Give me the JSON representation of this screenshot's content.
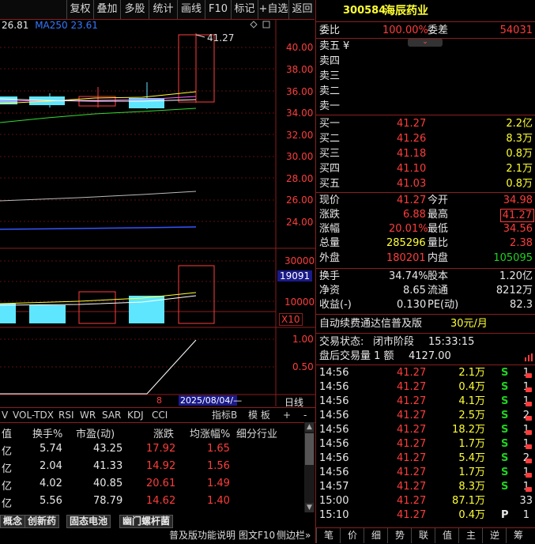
{
  "toolbar": {
    "items": [
      "复权",
      "叠加",
      "多股",
      "统计",
      "画线",
      "F10",
      "标记",
      "+自选",
      "返回"
    ]
  },
  "chart": {
    "ma_value": "26.81",
    "ma250_label": "MA250",
    "ma250_value": "23.61",
    "price_axis": [
      "40.00",
      "38.00",
      "36.00",
      "34.00",
      "32.00",
      "30.00",
      "28.00",
      "26.00",
      "24.00"
    ],
    "high_annotation": "41.27",
    "volume_axis": [
      "30000",
      "20000",
      "10000"
    ],
    "volume_current": "19091",
    "volume_unit": "X10",
    "indicator_axis": [
      "1.00",
      "0.50"
    ],
    "bottom_tick": "8",
    "date_label": "2025/08/04/—",
    "line_label": "日线"
  },
  "indicator_tabs": {
    "items": [
      "V",
      "VOL-TDX",
      "RSI",
      "WR",
      "SAR",
      "KDJ",
      "CCI"
    ],
    "right": [
      "指标B",
      "模 板",
      "+",
      "-"
    ]
  },
  "table": {
    "headers": [
      "值",
      "换手%",
      "市盈(动)",
      "涨跌",
      "均涨幅%",
      "细分行业"
    ],
    "rows": [
      [
        "亿",
        "5.74",
        "43.25",
        "17.92",
        "1.65"
      ],
      [
        "亿",
        "2.04",
        "41.33",
        "14.92",
        "1.56"
      ],
      [
        "亿",
        "4.02",
        "40.85",
        "20.61",
        "1.49"
      ],
      [
        "亿",
        "5.56",
        "78.79",
        "14.62",
        "1.40"
      ]
    ]
  },
  "concept_tags": [
    "概念",
    "创新药",
    "固态电池",
    "幽门螺杆菌"
  ],
  "footer": {
    "links": [
      "普及版功能说明",
      "图文F10",
      "侧边栏»"
    ],
    "right_tabs": [
      "笔",
      "价",
      "细",
      "势",
      "联",
      "值",
      "主",
      "逆",
      "筹"
    ]
  },
  "stock": {
    "code": "300584",
    "name": "海辰药业"
  },
  "orderbook": {
    "weibi_label": "委比",
    "weibi_value": "100.00%",
    "weicha_label": "委差",
    "weicha_value": "54031",
    "sells": [
      {
        "label": "卖五",
        "price": "¥"
      },
      {
        "label": "卖四",
        "price": ""
      },
      {
        "label": "卖三",
        "price": ""
      },
      {
        "label": "卖二",
        "price": ""
      },
      {
        "label": "卖一",
        "price": ""
      }
    ],
    "buys": [
      {
        "label": "买一",
        "price": "41.27",
        "vol": "2.2亿"
      },
      {
        "label": "买二",
        "price": "41.26",
        "vol": "8.3万"
      },
      {
        "label": "买三",
        "price": "41.18",
        "vol": "0.8万"
      },
      {
        "label": "买四",
        "price": "41.10",
        "vol": "2.1万"
      },
      {
        "label": "买五",
        "price": "41.03",
        "vol": "0.8万"
      }
    ]
  },
  "quote": {
    "rows": [
      {
        "l1": "现价",
        "v1": "41.27",
        "l2": "今开",
        "v2": "34.98"
      },
      {
        "l1": "涨跌",
        "v1": "6.88",
        "l2": "最高",
        "v2": "41.27"
      },
      {
        "l1": "涨幅",
        "v1": "20.01%",
        "l2": "最低",
        "v2": "34.56"
      },
      {
        "l1": "总量",
        "v1": "285296",
        "l2": "量比",
        "v2": "2.38"
      },
      {
        "l1": "外盘",
        "v1": "180201",
        "l2": "内盘",
        "v2": "105095"
      }
    ]
  },
  "fund": {
    "rows": [
      {
        "l1": "换手",
        "v1": "34.74%",
        "l2": "股本",
        "v2": "1.20亿"
      },
      {
        "l1": "净资",
        "v1": "8.65",
        "l2": "流通",
        "v2": "8212万"
      },
      {
        "l1": "收益(-)",
        "v1": "0.130",
        "l2": "PE(动)",
        "v2": "82.3"
      }
    ]
  },
  "promo": {
    "text": "自动续费通达信普及版",
    "price": "30元/月"
  },
  "trade_status": {
    "label": "交易状态:",
    "value": "闭市阶段",
    "time": "15:33:15",
    "after_label": "盘后交易量 1 额",
    "after_value": "4127.00"
  },
  "ticks": [
    {
      "t": "14:56",
      "p": "41.27",
      "v": "2.1万",
      "s": "S",
      "n": "1"
    },
    {
      "t": "14:56",
      "p": "41.27",
      "v": "0.4万",
      "s": "S",
      "n": "1"
    },
    {
      "t": "14:56",
      "p": "41.27",
      "v": "4.1万",
      "s": "S",
      "n": "1"
    },
    {
      "t": "14:56",
      "p": "41.27",
      "v": "2.5万",
      "s": "S",
      "n": "2"
    },
    {
      "t": "14:56",
      "p": "41.27",
      "v": "18.2万",
      "s": "S",
      "n": "1"
    },
    {
      "t": "14:56",
      "p": "41.27",
      "v": "1.7万",
      "s": "S",
      "n": "1"
    },
    {
      "t": "14:56",
      "p": "41.27",
      "v": "5.4万",
      "s": "S",
      "n": "2"
    },
    {
      "t": "14:56",
      "p": "41.27",
      "v": "1.7万",
      "s": "S",
      "n": "1"
    },
    {
      "t": "14:57",
      "p": "41.27",
      "v": "8.3万",
      "s": "S",
      "n": "1"
    },
    {
      "t": "15:00",
      "p": "41.27",
      "v": "87.1万",
      "s": "",
      "n": "33"
    },
    {
      "t": "15:10",
      "p": "41.27",
      "v": "0.4万",
      "s": "P",
      "n": "1"
    }
  ]
}
